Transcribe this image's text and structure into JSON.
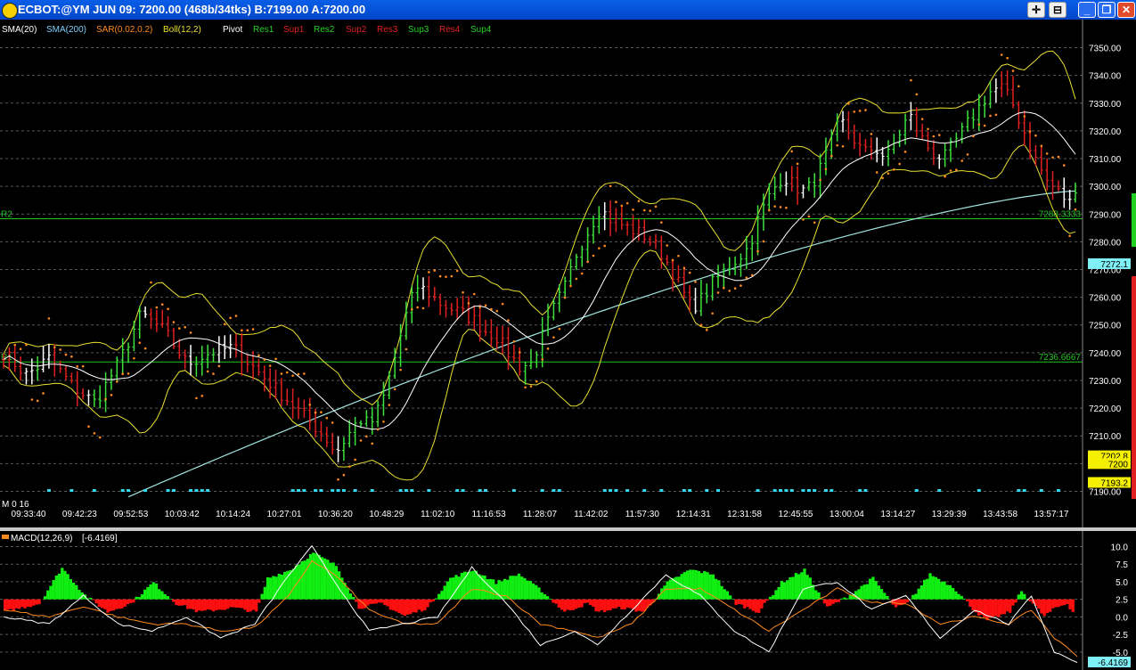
{
  "window": {
    "title": "ECBOT:@YM   JUN 09: 7200.00 (468b/34tks)  B:7199.00 A:7200.00",
    "buttons": {
      "crosshair": "✛",
      "pin": "⊟",
      "minimize": "_",
      "restore": "❐",
      "close": "✕"
    }
  },
  "legend": {
    "sma20": "SMA(20)",
    "sma200": "SMA(200)",
    "sar": "SAR(0.02,0.2)",
    "boll": "Boll(12,2)",
    "pivot": "Pivot",
    "res1": "Res1",
    "sup1": "Sup1",
    "res2": "Res2",
    "sup2": "Sup2",
    "res3": "Res3",
    "sup3": "Sup3",
    "res4": "Res4",
    "sup4": "Sup4"
  },
  "colors": {
    "up_bar": "#3ee23e",
    "down_bar": "#e02020",
    "neutral_bar": "#ffffff",
    "bollinger": "#e8e030",
    "sar": "#ff8a1e",
    "sma20": "#ffffff",
    "sma200": "#9fe6df",
    "pivot_line": "#22c422",
    "grid": "#5a5a5a",
    "macd_pos": "#11ee11",
    "macd_neg": "#ff1010",
    "macd_line": "#ffffff",
    "signal_line": "#ff8a1e",
    "marker": "#36d8f0"
  },
  "chart_data": [
    {
      "type": "line",
      "name": "price-chart",
      "ylim": [
        7185,
        7355
      ],
      "yticks": [
        "7350.00",
        "7340.00",
        "7330.00",
        "7320.00",
        "7310.00",
        "7300.00",
        "7290.00",
        "7280.00",
        "7270.00",
        "7260.00",
        "7250.00",
        "7240.00",
        "7230.00",
        "7220.00",
        "7210.00",
        "7200.00",
        "7190.00"
      ],
      "xticks": [
        "09:33:40",
        "09:42:23",
        "09:52:53",
        "10:03:42",
        "10:14:24",
        "10:27:01",
        "10:36:20",
        "10:48:29",
        "11:02:10",
        "11:16:53",
        "11:28:07",
        "11:42:02",
        "11:57:30",
        "12:14:31",
        "12:31:58",
        "12:45:55",
        "13:00:04",
        "13:14:27",
        "13:29:39",
        "13:43:58",
        "13:57:17"
      ],
      "pivot_lines": [
        {
          "label": "R2",
          "value": 7288.3333,
          "value_text": "7288.3333"
        },
        {
          "label": "R1",
          "value": 7236.6667,
          "value_text": "7236.6667"
        }
      ],
      "price_tags": [
        {
          "value": 7272.1,
          "text": "7272.1",
          "bg": "#7ff0f6"
        },
        {
          "value": 7202.8,
          "text": "7202.8",
          "bg": "#f4f000"
        },
        {
          "value": 7200.0,
          "text": "7200",
          "bg": "#f4f000"
        },
        {
          "value": 7193.2,
          "text": "7193.2",
          "bg": "#f4f000"
        }
      ],
      "marker_label": "M 0 16",
      "price_path": [
        [
          0,
          7240
        ],
        [
          4,
          7232
        ],
        [
          8,
          7238
        ],
        [
          12,
          7228
        ],
        [
          16,
          7222
        ],
        [
          20,
          7236
        ],
        [
          24,
          7254
        ],
        [
          28,
          7248
        ],
        [
          32,
          7236
        ],
        [
          36,
          7240
        ],
        [
          40,
          7242
        ],
        [
          44,
          7234
        ],
        [
          48,
          7226
        ],
        [
          52,
          7218
        ],
        [
          56,
          7210
        ],
        [
          58,
          7204
        ],
        [
          60,
          7210
        ],
        [
          62,
          7216
        ],
        [
          64,
          7214
        ],
        [
          66,
          7222
        ],
        [
          68,
          7236
        ],
        [
          70,
          7252
        ],
        [
          72,
          7264
        ],
        [
          74,
          7262
        ],
        [
          76,
          7258
        ],
        [
          78,
          7256
        ],
        [
          80,
          7254
        ],
        [
          82,
          7252
        ],
        [
          84,
          7248
        ],
        [
          86,
          7246
        ],
        [
          88,
          7240
        ],
        [
          90,
          7235
        ],
        [
          92,
          7236
        ],
        [
          94,
          7246
        ],
        [
          96,
          7256
        ],
        [
          98,
          7264
        ],
        [
          100,
          7276
        ],
        [
          102,
          7284
        ],
        [
          104,
          7292
        ],
        [
          106,
          7288
        ],
        [
          108,
          7286
        ],
        [
          110,
          7284
        ],
        [
          112,
          7282
        ],
        [
          114,
          7278
        ],
        [
          116,
          7272
        ],
        [
          118,
          7264
        ],
        [
          120,
          7256
        ],
        [
          122,
          7260
        ],
        [
          124,
          7266
        ],
        [
          126,
          7270
        ],
        [
          128,
          7274
        ],
        [
          130,
          7278
        ],
        [
          132,
          7290
        ],
        [
          134,
          7298
        ],
        [
          136,
          7304
        ],
        [
          138,
          7300
        ],
        [
          140,
          7298
        ],
        [
          142,
          7304
        ],
        [
          144,
          7314
        ],
        [
          146,
          7324
        ],
        [
          148,
          7318
        ],
        [
          150,
          7312
        ],
        [
          152,
          7314
        ],
        [
          154,
          7310
        ],
        [
          156,
          7318
        ],
        [
          158,
          7326
        ],
        [
          160,
          7318
        ],
        [
          162,
          7312
        ],
        [
          164,
          7310
        ],
        [
          166,
          7316
        ],
        [
          168,
          7322
        ],
        [
          170,
          7328
        ],
        [
          172,
          7334
        ],
        [
          174,
          7336
        ],
        [
          176,
          7330
        ],
        [
          178,
          7320
        ],
        [
          180,
          7310
        ],
        [
          182,
          7302
        ],
        [
          184,
          7298
        ],
        [
          186,
          7294
        ],
        [
          187,
          7300
        ]
      ]
    },
    {
      "type": "area",
      "name": "MACD(12,26,9)",
      "value_text": "[-6.4169]",
      "current_value": -6.4169,
      "ylim": [
        -7.3,
        11.2
      ],
      "yticks": [
        "10.0",
        "7.5",
        "5.0",
        "2.5",
        "0.0",
        "-2.5",
        "-5.0"
      ],
      "baseline": 2.5,
      "histogram": [
        [
          0,
          -3
        ],
        [
          6,
          -1
        ],
        [
          10,
          7.5
        ],
        [
          14,
          1
        ],
        [
          18,
          -3
        ],
        [
          22,
          -1
        ],
        [
          26,
          4
        ],
        [
          30,
          -1
        ],
        [
          34,
          -3
        ],
        [
          40,
          -2
        ],
        [
          44,
          -3
        ],
        [
          46,
          5
        ],
        [
          50,
          7
        ],
        [
          54,
          11
        ],
        [
          58,
          8
        ],
        [
          62,
          -2
        ],
        [
          66,
          -1
        ],
        [
          70,
          -4
        ],
        [
          74,
          -2
        ],
        [
          78,
          5
        ],
        [
          82,
          7
        ],
        [
          86,
          4
        ],
        [
          90,
          6
        ],
        [
          94,
          2
        ],
        [
          98,
          -3
        ],
        [
          102,
          -1
        ],
        [
          104,
          -3
        ],
        [
          108,
          -2
        ],
        [
          112,
          -3
        ],
        [
          116,
          4
        ],
        [
          120,
          7
        ],
        [
          124,
          6
        ],
        [
          128,
          -1
        ],
        [
          132,
          -3
        ],
        [
          136,
          4
        ],
        [
          140,
          7
        ],
        [
          144,
          -2
        ],
        [
          148,
          1
        ],
        [
          152,
          5
        ],
        [
          156,
          -2
        ],
        [
          158,
          -1
        ],
        [
          162,
          6
        ],
        [
          166,
          3
        ],
        [
          170,
          -3
        ],
        [
          172,
          -5
        ],
        [
          176,
          -3
        ],
        [
          178,
          2
        ],
        [
          182,
          -4
        ],
        [
          184,
          -2
        ],
        [
          186,
          -1
        ],
        [
          187,
          -3
        ]
      ],
      "macd_line": [
        [
          0,
          0
        ],
        [
          8,
          -1
        ],
        [
          14,
          3
        ],
        [
          20,
          -1
        ],
        [
          26,
          -2
        ],
        [
          32,
          0
        ],
        [
          38,
          -3
        ],
        [
          44,
          -1
        ],
        [
          50,
          6
        ],
        [
          54,
          10
        ],
        [
          58,
          5
        ],
        [
          64,
          -2
        ],
        [
          70,
          -1
        ],
        [
          76,
          0
        ],
        [
          82,
          7
        ],
        [
          88,
          2
        ],
        [
          94,
          -4
        ],
        [
          100,
          -2
        ],
        [
          104,
          -4
        ],
        [
          110,
          1
        ],
        [
          116,
          6
        ],
        [
          122,
          3
        ],
        [
          128,
          -2
        ],
        [
          134,
          -5
        ],
        [
          140,
          4
        ],
        [
          146,
          5
        ],
        [
          152,
          1
        ],
        [
          158,
          3
        ],
        [
          164,
          -3
        ],
        [
          170,
          1
        ],
        [
          176,
          -1
        ],
        [
          180,
          3
        ],
        [
          184,
          -5
        ],
        [
          188,
          -6.4
        ]
      ],
      "signal_line": [
        [
          0,
          1
        ],
        [
          8,
          0
        ],
        [
          14,
          1.5
        ],
        [
          20,
          0
        ],
        [
          26,
          -1
        ],
        [
          32,
          -1
        ],
        [
          38,
          -2
        ],
        [
          44,
          -1.5
        ],
        [
          50,
          3
        ],
        [
          54,
          8
        ],
        [
          58,
          6
        ],
        [
          64,
          1
        ],
        [
          70,
          -1
        ],
        [
          76,
          -1
        ],
        [
          82,
          4
        ],
        [
          88,
          3
        ],
        [
          94,
          -1
        ],
        [
          100,
          -2
        ],
        [
          104,
          -3
        ],
        [
          110,
          -1
        ],
        [
          116,
          4
        ],
        [
          122,
          4
        ],
        [
          128,
          1
        ],
        [
          134,
          -2
        ],
        [
          140,
          1
        ],
        [
          146,
          4
        ],
        [
          152,
          2
        ],
        [
          158,
          2
        ],
        [
          164,
          -1
        ],
        [
          170,
          0
        ],
        [
          176,
          -1
        ],
        [
          180,
          1
        ],
        [
          184,
          -3
        ],
        [
          188,
          -5.5
        ]
      ]
    }
  ]
}
